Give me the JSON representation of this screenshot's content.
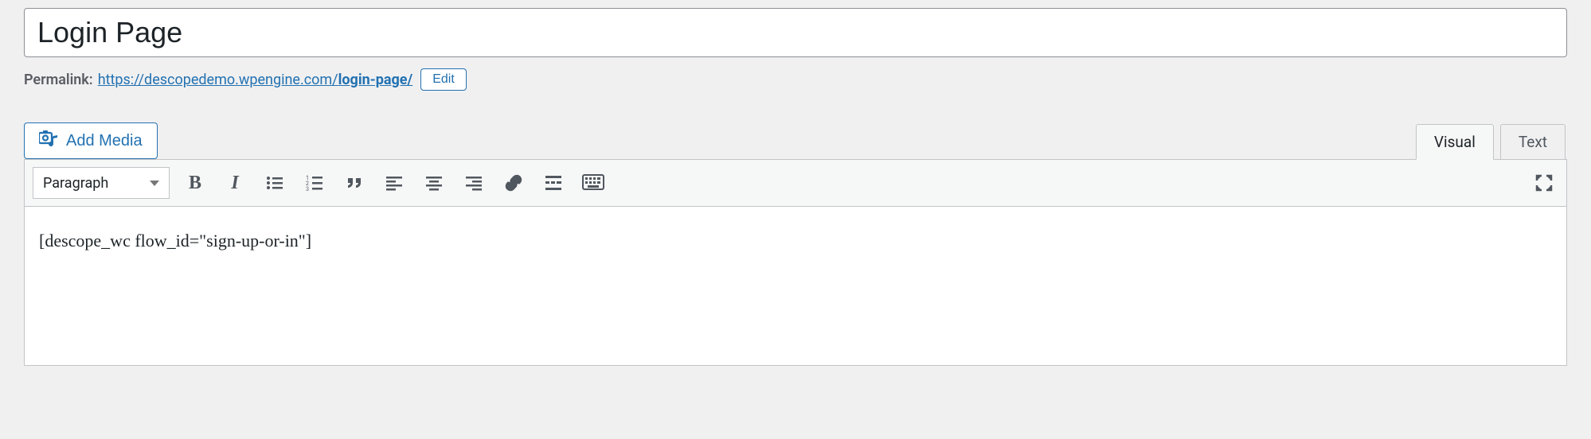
{
  "title": "Login Page",
  "permalink": {
    "label": "Permalink:",
    "base": "https://descopedemo.wpengine.com/",
    "slug": "login-page/",
    "edit_label": "Edit"
  },
  "add_media_label": "Add Media",
  "tabs": {
    "visual": "Visual",
    "text": "Text"
  },
  "toolbar": {
    "format_label": "Paragraph"
  },
  "content": "[descope_wc flow_id=\"sign-up-or-in\"]"
}
